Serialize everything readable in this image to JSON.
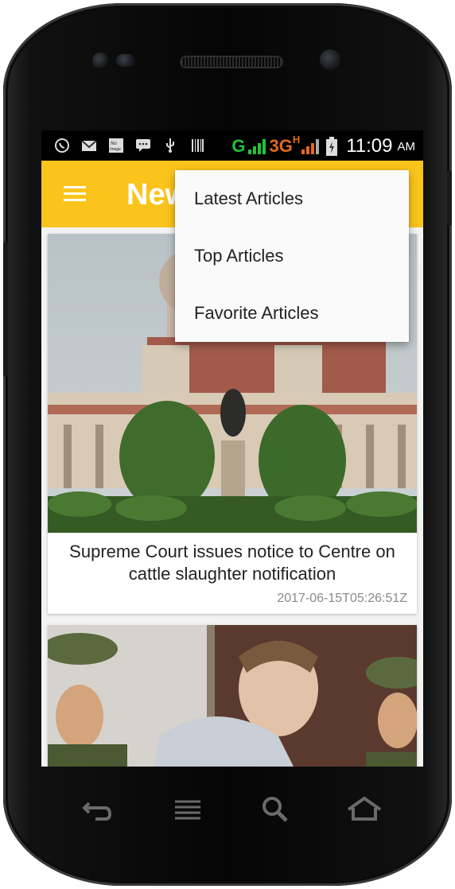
{
  "statusbar": {
    "icons": [
      "whatsapp-icon",
      "gmail-icon",
      "no-image-icon",
      "chat-icon",
      "usb-icon",
      "barcode-icon"
    ],
    "network_g": "G",
    "network_3g": "3G",
    "network_h": "H",
    "time": "11:09",
    "ampm": "AM"
  },
  "appbar": {
    "title": "News"
  },
  "overflow_menu": {
    "items": [
      {
        "label": "Latest Articles"
      },
      {
        "label": "Top Articles"
      },
      {
        "label": "Favorite Articles"
      }
    ]
  },
  "articles": [
    {
      "headline": "Supreme Court issues notice to Centre on cattle slaughter notification",
      "date": "2017-06-15T05:26:51Z"
    },
    {
      "headline": "",
      "date": ""
    }
  ],
  "colors": {
    "appbar": "#fbc41c",
    "statusbar": "#000000",
    "network_g": "#22c33a",
    "network_3g": "#e26a1c"
  },
  "navbar": {
    "buttons": [
      "back-icon",
      "menu-icon",
      "search-icon",
      "home-icon"
    ]
  }
}
